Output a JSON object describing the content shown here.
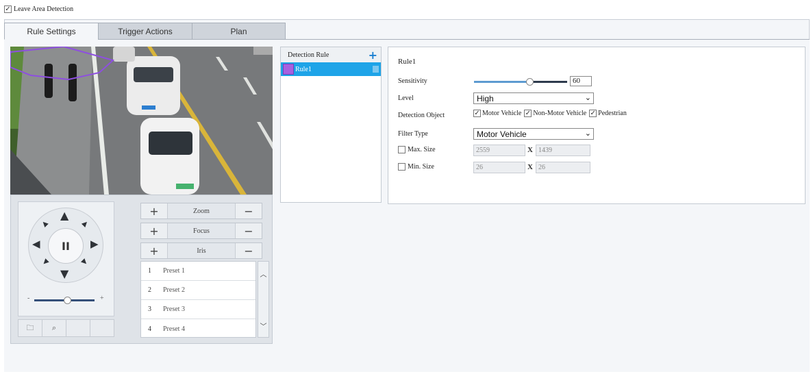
{
  "leave_area_detection": {
    "label": "Leave Area Detection",
    "checked": true
  },
  "tabs": [
    {
      "label": "Rule Settings",
      "active": true
    },
    {
      "label": "Trigger Actions",
      "active": false
    },
    {
      "label": "Plan",
      "active": false
    }
  ],
  "ptz": {
    "center_symbol": "II",
    "controls": [
      {
        "label": "Zoom",
        "plus": "+",
        "minus": "−"
      },
      {
        "label": "Focus",
        "plus": "+",
        "minus": "−"
      },
      {
        "label": "Iris",
        "plus": "+",
        "minus": "−"
      }
    ],
    "speed_min": "-",
    "speed_max": "+",
    "speed_level": 0.55,
    "presets": [
      {
        "num": "1",
        "name": "Preset 1"
      },
      {
        "num": "2",
        "name": "Preset 2"
      },
      {
        "num": "3",
        "name": "Preset 3"
      },
      {
        "num": "4",
        "name": "Preset 4"
      }
    ]
  },
  "detection_rule": {
    "header": "Detection Rule",
    "add": "+",
    "items": [
      {
        "label": "Rule1",
        "color": "#a861e0",
        "selected": true
      }
    ]
  },
  "settings": {
    "rule_title": "Rule1",
    "sensitivity_label": "Sensitivity",
    "sensitivity_value": "60",
    "sensitivity_level": 0.6,
    "level_label": "Level",
    "level_value": "High",
    "detection_object_label": "Detection Object",
    "objects": [
      {
        "label": "Motor Vehicle",
        "checked": true
      },
      {
        "label": "Non-Motor Vehicle",
        "checked": true
      },
      {
        "label": "Pedestrian",
        "checked": true
      }
    ],
    "filter_type_label": "Filter Type",
    "filter_type_value": "Motor Vehicle",
    "max_size_label": "Max. Size",
    "max_size_checked": false,
    "max_w": "2559",
    "max_h": "1439",
    "min_size_label": "Min. Size",
    "min_size_checked": false,
    "min_w": "26",
    "min_h": "26",
    "x_sep": "X"
  },
  "colors": {
    "accent": "#1ea4e8",
    "rule_color": "#a861e0",
    "add_icon": "#1a7fd1"
  }
}
